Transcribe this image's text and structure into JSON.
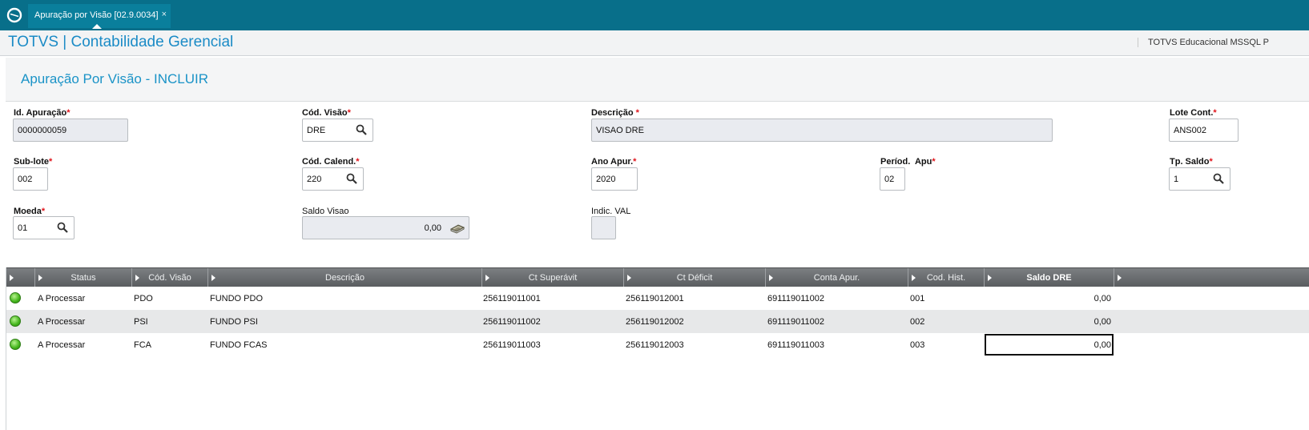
{
  "tab": {
    "title": "Apuração por Visão [02.9.0034]",
    "close": "×"
  },
  "app": {
    "title": "TOTVS | Contabilidade Gerencial",
    "environment": "TOTVS Educacional MSSQL P"
  },
  "form": {
    "title": "Apuração Por Visão - INCLUIR",
    "fields": {
      "id_apuracao": {
        "label": "Id. Apuração",
        "value": "0000000059"
      },
      "cod_visao": {
        "label": "Cód. Visão",
        "value": "DRE"
      },
      "descricao": {
        "label": "Descrição ",
        "value": "VISAO DRE"
      },
      "lote_cont": {
        "label": "Lote Cont.",
        "value": "ANS002"
      },
      "sub_lote": {
        "label": "Sub-lote",
        "value": "002"
      },
      "cod_calend": {
        "label": "Cód. Calend.",
        "value": "220"
      },
      "ano_apur": {
        "label": "Ano Apur.",
        "value": "2020"
      },
      "period_apu": {
        "label": "Períod.  Apu",
        "value": "02"
      },
      "tp_saldo": {
        "label": "Tp. Saldo",
        "value": "1"
      },
      "moeda": {
        "label": "Moeda",
        "value": "01"
      },
      "saldo_visao": {
        "label": "Saldo Visao",
        "value": "0,00"
      },
      "indic_val": {
        "label": "Indic. VAL",
        "value": ""
      }
    },
    "required_mark": "*"
  },
  "grid": {
    "columns": [
      "Status",
      "Cód. Visão",
      "Descrição",
      "Ct Superávit",
      "Ct Déficit",
      "Conta Apur.",
      "Cod. Hist.",
      "Saldo DRE"
    ],
    "rows": [
      {
        "status": "A Processar",
        "cod_visao": "PDO",
        "descricao": "FUNDO PDO",
        "ct_superavit": "256119011001",
        "ct_deficit": "256119012001",
        "conta_apur": "691119011002",
        "cod_hist": "001",
        "saldo_dre": "0,00"
      },
      {
        "status": "A Processar",
        "cod_visao": "PSI",
        "descricao": "FUNDO PSI",
        "ct_superavit": "256119011002",
        "ct_deficit": "256119012002",
        "conta_apur": "691119011002",
        "cod_hist": "002",
        "saldo_dre": "0,00"
      },
      {
        "status": "A Processar",
        "cod_visao": "FCA",
        "descricao": "FUNDO FCAS",
        "ct_superavit": "256119011003",
        "ct_deficit": "256119012003",
        "conta_apur": "691119011003",
        "cod_hist": "003",
        "saldo_dre": "0,00"
      }
    ]
  },
  "colors": {
    "topbar": "#086f8a",
    "title_blue": "#1b8bc6",
    "required": "#e0141b",
    "status_green": "#43b51b"
  },
  "icons": {
    "logo": "totvs-logo-icon",
    "search": "search-icon",
    "money": "money-icon",
    "status": "status-dot-icon"
  }
}
